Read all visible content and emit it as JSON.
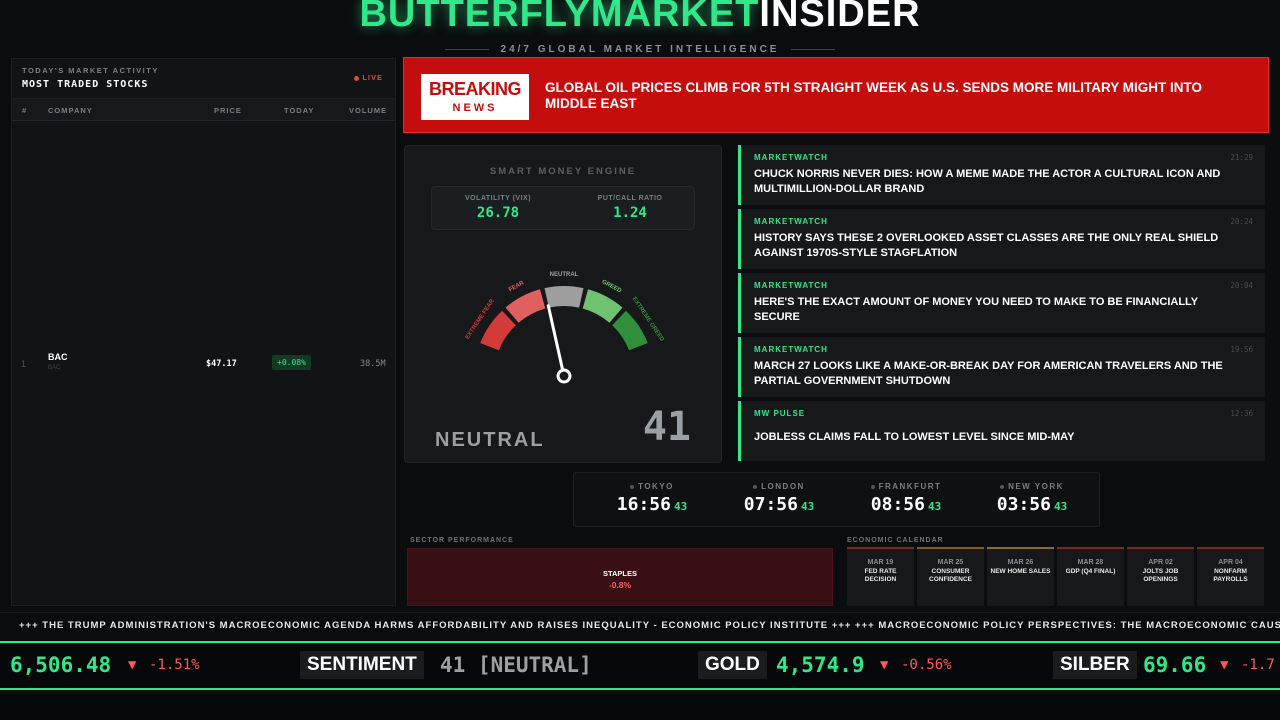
{
  "brand": {
    "part1": "BUTTERFLYMARKET",
    "part2": "INSIDER",
    "tagline": "24/7 GLOBAL MARKET INTELLIGENCE"
  },
  "market_panel": {
    "kicker": "TODAY'S MARKET ACTIVITY",
    "title": "MOST TRADED STOCKS",
    "live": "LIVE",
    "columns": [
      "#",
      "COMPANY",
      "PRICE",
      "TODAY",
      "VOLUME"
    ],
    "rows": [
      {
        "rank": "1",
        "ticker": "BAC",
        "sub": "BAC",
        "price": "$47.17",
        "change": "+0.08%",
        "volume": "38.5M"
      }
    ]
  },
  "breaking": {
    "badge1": "BREAKING",
    "badge2": "NEWS",
    "headline": "GLOBAL OIL PRICES CLIMB FOR 5TH STRAIGHT WEEK AS U.S. SENDS MORE MILITARY MIGHT INTO MIDDLE EAST"
  },
  "engine": {
    "title": "SMART MONEY ENGINE",
    "vix_label": "VOLATILITY (VIX)",
    "vix": "26.78",
    "pc_label": "PUT/CALL RATIO",
    "pc": "1.24",
    "zones": [
      "EXTREME FEAR",
      "FEAR",
      "NEUTRAL",
      "GREED",
      "EXTREME GREED"
    ],
    "state": "NEUTRAL",
    "score": "41",
    "score_value": 41
  },
  "news": [
    {
      "source": "MARKETWATCH",
      "time": "21:29",
      "headline": "CHUCK NORRIS NEVER DIES: HOW A MEME MADE THE ACTOR A CULTURAL ICON AND MULTIMILLION-DOLLAR BRAND"
    },
    {
      "source": "MARKETWATCH",
      "time": "20:24",
      "headline": "HISTORY SAYS THESE 2 OVERLOOKED ASSET CLASSES ARE THE ONLY REAL SHIELD AGAINST 1970S-STYLE STAGFLATION"
    },
    {
      "source": "MARKETWATCH",
      "time": "20:04",
      "headline": "HERE'S THE EXACT AMOUNT OF MONEY YOU NEED TO MAKE TO BE FINANCIALLY SECURE"
    },
    {
      "source": "MARKETWATCH",
      "time": "19:56",
      "headline": "MARCH 27 LOOKS LIKE A MAKE-OR-BREAK DAY FOR AMERICAN TRAVELERS AND THE PARTIAL GOVERNMENT SHUTDOWN"
    },
    {
      "source": "MW PULSE",
      "time": "12:36",
      "headline": "JOBLESS CLAIMS FALL TO LOWEST LEVEL SINCE MID-MAY"
    }
  ],
  "clocks": [
    {
      "city": "TOKYO",
      "time": "16:56",
      "sec": "43"
    },
    {
      "city": "LONDON",
      "time": "07:56",
      "sec": "43"
    },
    {
      "city": "FRANKFURT",
      "time": "08:56",
      "sec": "43"
    },
    {
      "city": "NEW YORK",
      "time": "03:56",
      "sec": "43"
    }
  ],
  "sector": {
    "title": "SECTOR PERFORMANCE",
    "name": "STAPLES",
    "value": "-0.8%"
  },
  "calendar": {
    "title": "ECONOMIC CALENDAR",
    "events": [
      {
        "date": "MAR 19",
        "event": "FED RATE DECISION"
      },
      {
        "date": "MAR 25",
        "event": "CONSUMER CONFIDENCE"
      },
      {
        "date": "MAR 26",
        "event": "NEW HOME SALES"
      },
      {
        "date": "MAR 28",
        "event": "GDP (Q4 FINAL)"
      },
      {
        "date": "APR 02",
        "event": "JOLTS JOB OPENINGS"
      },
      {
        "date": "APR 04",
        "event": "NONFARM PAYROLLS"
      }
    ]
  },
  "ticker_text": "+++ THE TRUMP ADMINISTRATION'S MACROECONOMIC AGENDA HARMS AFFORDABILITY AND RAISES INEQUALITY - ECONOMIC POLICY INSTITUTE +++ +++ MACROECONOMIC POLICY PERSPECTIVES: THE MACROECONOMIC CAUSES AN",
  "quotes": {
    "q1_value": "6,506.48",
    "q1_arrow": "▼",
    "q1_change": "-1.51%",
    "sentiment_label": "SENTIMENT",
    "sentiment_value": "41 [NEUTRAL]",
    "gold_label": "GOLD",
    "gold_value": "4,574.9",
    "gold_arrow": "▼",
    "gold_change": "-0.56%",
    "silver_label": "SILBER",
    "silver_value": "69.66",
    "silver_arrow": "▼",
    "silver_change": "-1.7"
  },
  "colors": {
    "accent": "#2ee88a",
    "breaking": "#c40d0d",
    "down": "#ff5a5a"
  }
}
